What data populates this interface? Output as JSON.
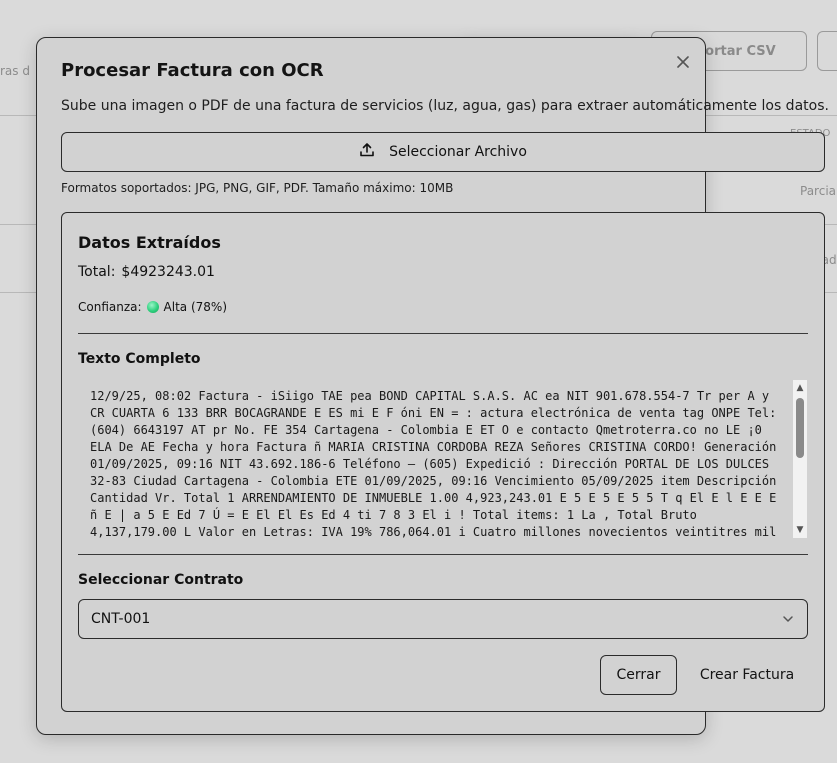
{
  "background": {
    "partial_text": "ras d",
    "import_button": "mportar CSV",
    "column_header": "ESTADO",
    "row1_status": "Parcia",
    "row2_status": "Pagad"
  },
  "dialog": {
    "title": "Procesar Factura con OCR",
    "description": "Sube una imagen o PDF de una factura de servicios (luz, agua, gas) para extraer automáticamente los datos.",
    "upload_label": "Seleccionar Archivo",
    "formats": "Formatos soportados: JPG, PNG, GIF, PDF. Tamaño máximo: 10MB"
  },
  "extracted": {
    "title": "Datos Extraídos",
    "total_label": "Total:",
    "total_value": "$4923243.01",
    "confidence_label": "Confianza:",
    "confidence_value": "Alta (78%)",
    "confidence_color": "#2fd07e"
  },
  "full_text": {
    "title": "Texto Completo",
    "content": "12/9/25, 08:02 Factura - iSiigo TAE pea BOND CAPITAL S.A.S. AC ea NIT 901.678.554-7 Tr per A y CR CUARTA 6 133 BRR BOCAGRANDE E ES mi E F óni EN = : actura electrónica de venta tag ONPE Tel: (604) 6643197 AT pr No. FE 354 Cartagena - Colombia E ET O e contacto Qmetroterra.co no LE ¡0 ELA De AE Fecha y hora Factura ñ MARIA CRISTINA CORDOBA REZA Señores CRISTINA CORDO! Generación 01/09/2025, 09:16 NIT 43.692.186-6 Teléfono — (605) Expedició : Dirección PORTAL DE LOS DULCES 32-83 Ciudad Cartagena - Colombia ETE 01/09/2025, 09:16 Vencimiento 05/09/2025 item Descripción Cantidad Vr. Total 1 ARRENDAMIENTO DE INMUEBLE 1.00 4,923,243.01 E 5 E 5 E 5 5 T q El E l E E E ñ E | a 5 E Ed 7 Ú = E El El Es Ed 4 ti 7 8 3 El i ! Total items: 1 La , Total Bruto 4,137,179.00 L Valor en Letras: IVA 19% 786,064.01 i Cuatro millones novecientos veintitres mil"
  },
  "contract": {
    "label": "Seleccionar Contrato",
    "selected": "CNT-001"
  },
  "actions": {
    "close_label": "Cerrar",
    "create_label": "Crear Factura"
  }
}
